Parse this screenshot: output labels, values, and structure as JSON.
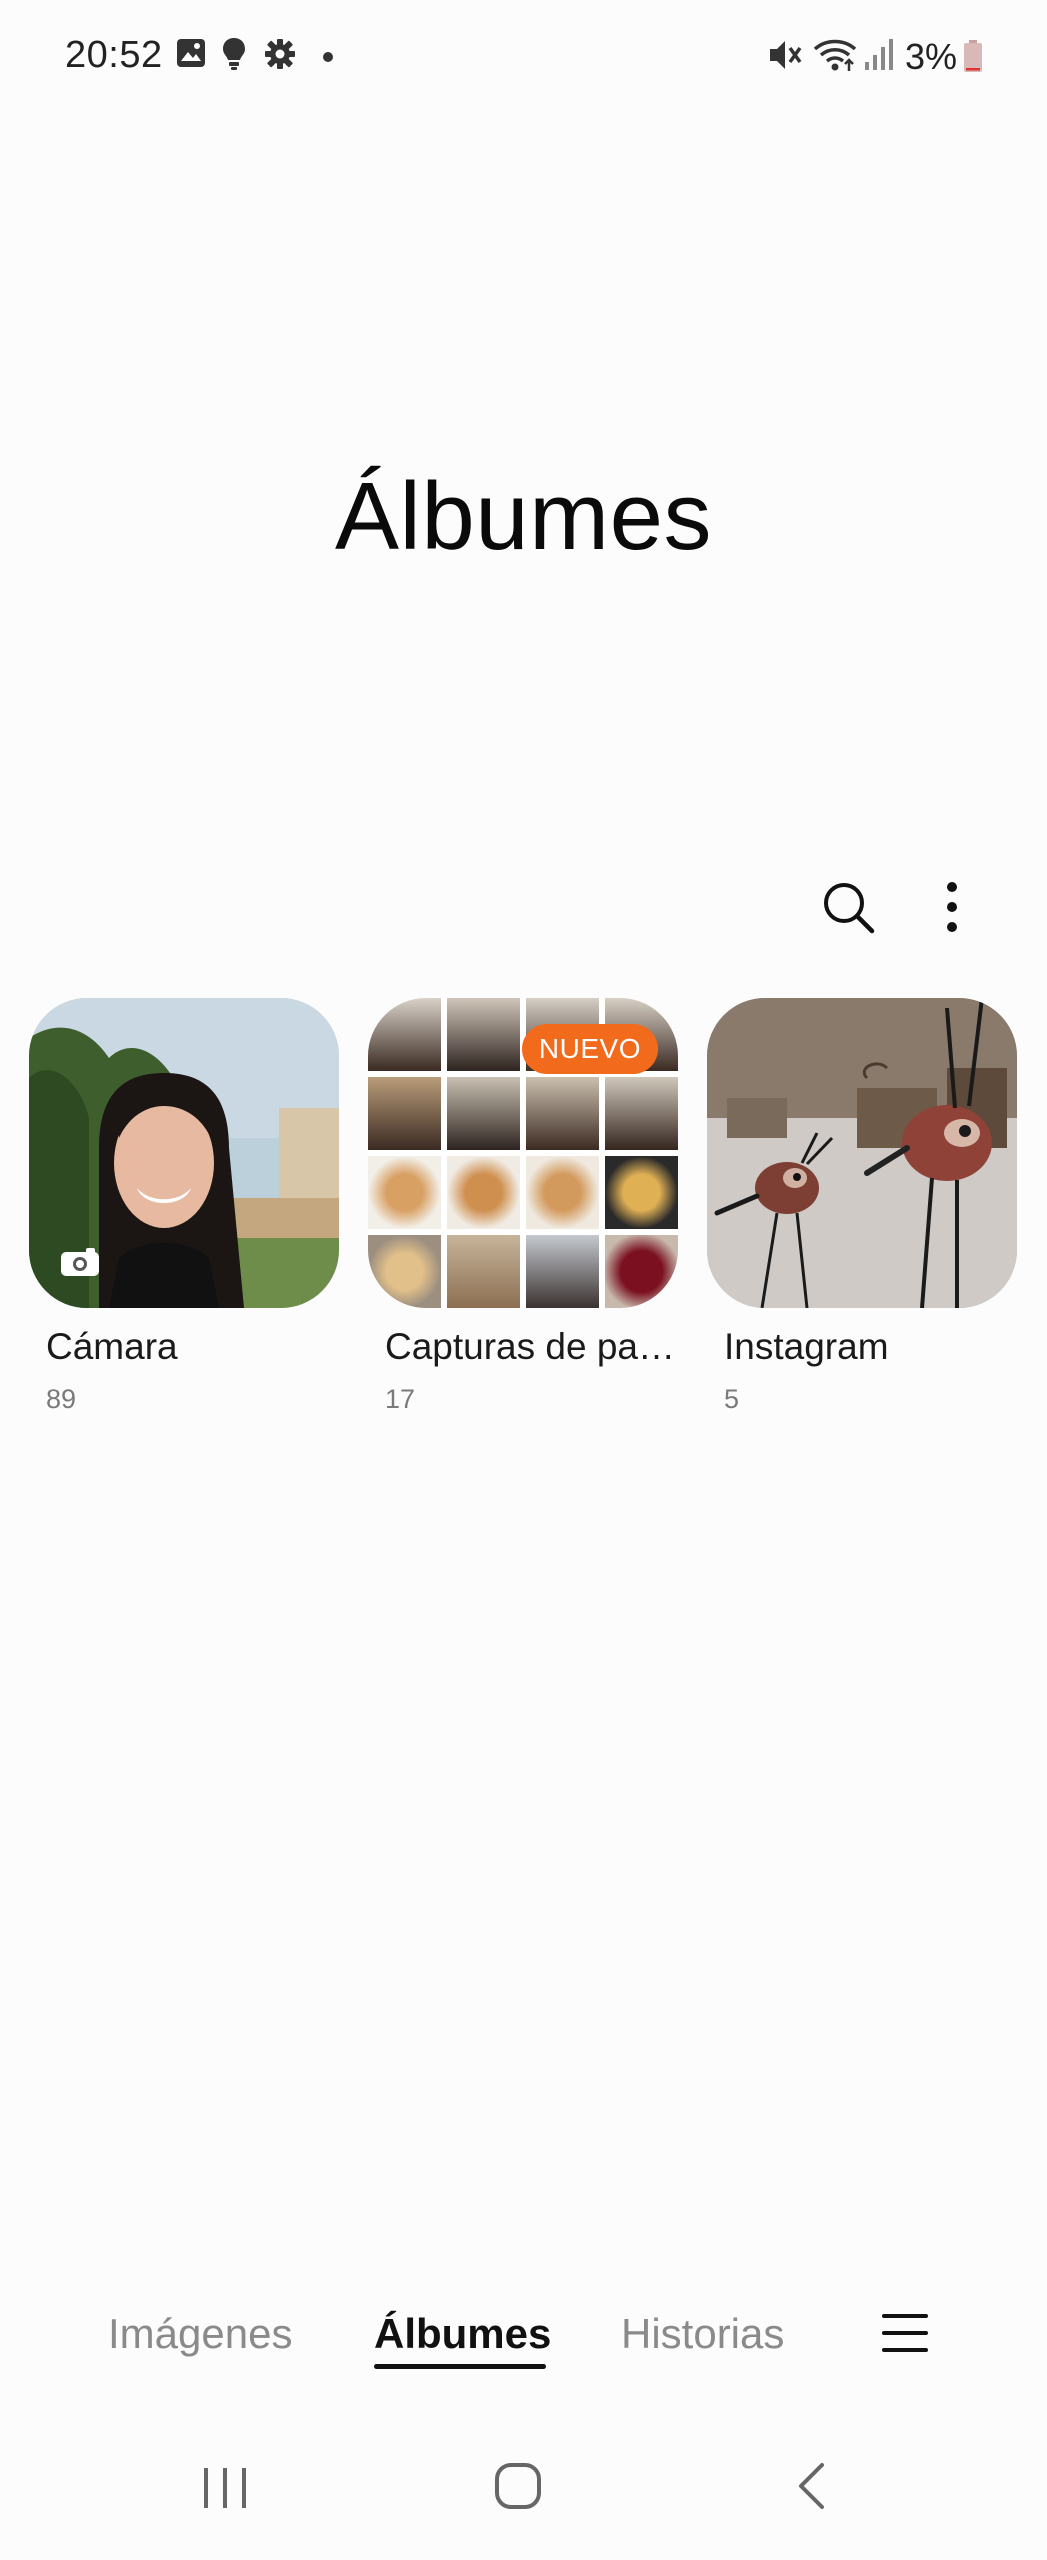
{
  "status_bar": {
    "time": "20:52",
    "battery": "3%",
    "icons_left": [
      "gallery-icon",
      "bulb-icon",
      "settings-icon",
      "dot-icon"
    ],
    "icons_right": [
      "mute-icon",
      "wifi-icon",
      "signal-icon",
      "battery-icon"
    ]
  },
  "page": {
    "title": "Álbumes"
  },
  "toolbar": {
    "search_icon": "search-icon",
    "more_icon": "more-vertical-icon"
  },
  "albums": [
    {
      "name": "Cámara",
      "count": "89",
      "badge": "",
      "overlay_icon": "camera-icon"
    },
    {
      "name": "Capturas de pa…",
      "count": "17",
      "badge": "NUEVO",
      "overlay_icon": ""
    },
    {
      "name": "Instagram",
      "count": "5",
      "badge": "",
      "overlay_icon": ""
    }
  ],
  "bottom_nav": {
    "tabs": [
      {
        "label": "Imágenes",
        "active": false
      },
      {
        "label": "Álbumes",
        "active": true
      },
      {
        "label": "Historias",
        "active": false
      }
    ],
    "menu_icon": "hamburger-icon"
  },
  "system_nav": [
    "recents-icon",
    "home-icon",
    "back-icon"
  ],
  "colors": {
    "badge": "#f26b1d",
    "background": "#fcfcfc",
    "text_secondary": "#7a7a7a"
  }
}
